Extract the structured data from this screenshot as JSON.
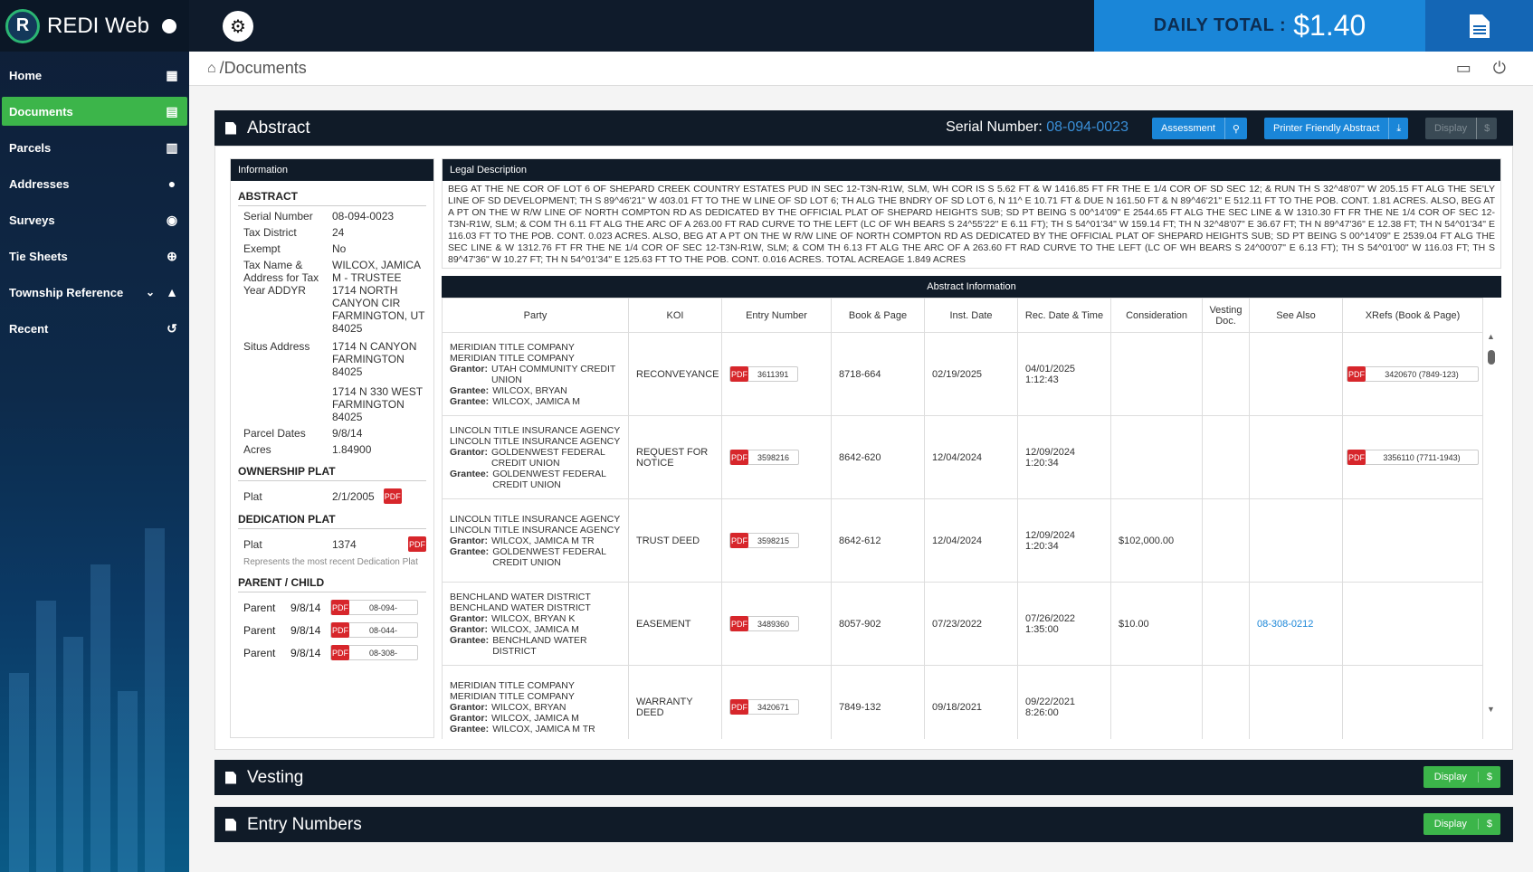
{
  "app": {
    "name": "REDI Web",
    "logo_letter": "R"
  },
  "topbar": {
    "daily_label": "DAILY TOTAL :",
    "daily_value": "$1.40"
  },
  "nav": [
    {
      "label": "Home",
      "icon": "dashboard-icon",
      "glyph": "▦"
    },
    {
      "label": "Documents",
      "icon": "file-icon",
      "glyph": "▤",
      "active": true
    },
    {
      "label": "Parcels",
      "icon": "map-icon",
      "glyph": "▥"
    },
    {
      "label": "Addresses",
      "icon": "map-pin-icon",
      "glyph": "●"
    },
    {
      "label": "Surveys",
      "icon": "compass-icon",
      "glyph": "◉"
    },
    {
      "label": "Tie Sheets",
      "icon": "crosshair-icon",
      "glyph": "⊕"
    },
    {
      "label": "Township Reference",
      "icon": "mountain-icon",
      "glyph": "▲",
      "expandable": true
    },
    {
      "label": "Recent",
      "icon": "history-icon",
      "glyph": "↺"
    }
  ],
  "breadcrumb": {
    "path": "/Documents"
  },
  "abstract": {
    "title": "Abstract",
    "serial_label": "Serial Number:",
    "serial_value": "08-094-0023",
    "assessment_label": "Assessment",
    "printer_label": "Printer Friendly Abstract",
    "display_label": "Display",
    "price_symbol": "$"
  },
  "info": {
    "header": "Information",
    "abstract_title": "ABSTRACT",
    "serial_number_label": "Serial Number",
    "serial_number": "08-094-0023",
    "tax_district_label": "Tax District",
    "tax_district": "24",
    "exempt_label": "Exempt",
    "exempt": "No",
    "tax_name_label": "Tax Name & Address for Tax Year ADDYR",
    "tax_name": "WILCOX, JAMICA M - TRUSTEE 1714 NORTH CANYON CIR FARMINGTON, UT 84025",
    "situs_label": "Situs Address",
    "situs_1": "1714 N CANYON FARMINGTON 84025",
    "situs_2": "1714 N 330 WEST FARMINGTON 84025",
    "parcel_dates_label": "Parcel Dates",
    "parcel_dates": "9/8/14",
    "acres_label": "Acres",
    "acres": "1.84900",
    "ownership_title": "OWNERSHIP PLAT",
    "ownership_plat_label": "Plat",
    "ownership_plat_value": "2/1/2005",
    "dedication_title": "DEDICATION PLAT",
    "dedication_plat_label": "Plat",
    "dedication_plat_value": "1374",
    "dedication_note": "Represents the most recent Dedication Plat",
    "parent_child_title": "PARENT / CHILD",
    "parents": [
      {
        "label": "Parent",
        "date": "9/8/14",
        "ref": "08-094-"
      },
      {
        "label": "Parent",
        "date": "9/8/14",
        "ref": "08-044-"
      },
      {
        "label": "Parent",
        "date": "9/8/14",
        "ref": "08-308-"
      }
    ]
  },
  "legal": {
    "header": "Legal Description",
    "text": "BEG AT THE NE COR OF LOT 6 OF SHEPARD CREEK COUNTRY ESTATES PUD IN SEC 12-T3N-R1W, SLM, WH COR IS S 5.62 FT & W 1416.85 FT FR THE E 1/4 COR OF SD SEC 12; & RUN TH S 32^48'07\" W 205.15 FT ALG THE SE'LY LINE OF SD DEVELOPMENT; TH S 89^46'21\" W 403.01 FT TO THE W LINE OF SD LOT 6; TH ALG THE BNDRY OF SD LOT 6, N 11^ E 10.71 FT & DUE N 161.50 FT & N 89^46'21\" E 512.11 FT TO THE POB. CONT. 1.81 ACRES. ALSO, BEG AT A PT ON THE W R/W LINE OF NORTH COMPTON RD AS DEDICATED BY THE OFFICIAL PLAT OF SHEPARD HEIGHTS SUB; SD PT BEING S 00^14'09\" E 2544.65 FT ALG THE SEC LINE & W 1310.30 FT FR THE NE 1/4 COR OF SEC 12-T3N-R1W, SLM; & COM TH 6.11 FT ALG THE ARC OF A 263.00 FT RAD CURVE TO THE LEFT (LC OF WH BEARS S 24^55'22\" E 6.11 FT); TH S 54^01'34\" W 159.14 FT; TH N 32^48'07\" E 36.67 FT; TH N 89^47'36\" E 12.38 FT; TH N 54^01'34\" E 116.03 FT TO THE POB. CONT. 0.023 ACRES. ALSO, BEG AT A PT ON THE W R/W LINE OF NORTH COMPTON RD AS DEDICATED BY THE OFFICIAL PLAT OF SHEPARD HEIGHTS SUB; SD PT BEING S 00^14'09\" E 2539.04 FT ALG THE SEC LINE & W 1312.76 FT FR THE NE 1/4 COR OF SEC 12-T3N-R1W, SLM; & COM TH 6.13 FT ALG THE ARC OF A 263.60 FT RAD CURVE TO THE LEFT (LC OF WH BEARS S 24^00'07\" E 6.13 FT); TH S 54^01'00\" W 116.03 FT; TH S 89^47'36\" W 10.27 FT; TH N 54^01'34\" E 125.63 FT TO THE POB. CONT. 0.016 ACRES. TOTAL ACREAGE 1.849 ACRES"
  },
  "absinfo": {
    "header": "Abstract Information",
    "columns": [
      "Party",
      "KOI",
      "Entry Number",
      "Book & Page",
      "Inst. Date",
      "Rec. Date & Time",
      "Consideration",
      "Vesting Doc.",
      "See Also",
      "XRefs (Book & Page)"
    ],
    "rows": [
      {
        "party": [
          {
            "t": "MERIDIAN TITLE COMPANY"
          },
          {
            "t": "MERIDIAN TITLE COMPANY"
          },
          {
            "k": "Grantor:",
            "t": "UTAH COMMUNITY CREDIT UNION"
          },
          {
            "k": "Grantee:",
            "t": "WILCOX, BRYAN"
          },
          {
            "k": "Grantee:",
            "t": "WILCOX, JAMICA M"
          }
        ],
        "koi": "RECONVEYANCE",
        "entry": "3611391",
        "book": "8718-664",
        "inst": "02/19/2025",
        "rec": "04/01/2025 1:12:43",
        "consideration": "",
        "vesting": "",
        "see_also": "",
        "xref": "3420670 (7849-123)"
      },
      {
        "party": [
          {
            "t": "LINCOLN TITLE INSURANCE AGENCY"
          },
          {
            "t": "LINCOLN TITLE INSURANCE AGENCY"
          },
          {
            "k": "Grantor:",
            "t": "GOLDENWEST FEDERAL CREDIT UNION"
          },
          {
            "k": "Grantee:",
            "t": "GOLDENWEST FEDERAL CREDIT UNION"
          }
        ],
        "koi": "REQUEST FOR NOTICE",
        "entry": "3598216",
        "book": "8642-620",
        "inst": "12/04/2024",
        "rec": "12/09/2024 1:20:34",
        "consideration": "",
        "vesting": "",
        "see_also": "",
        "xref": "3356110 (7711-1943)"
      },
      {
        "party": [
          {
            "t": "LINCOLN TITLE INSURANCE AGENCY"
          },
          {
            "t": "LINCOLN TITLE INSURANCE AGENCY"
          },
          {
            "k": "Grantor:",
            "t": "WILCOX, JAMICA M TR"
          },
          {
            "k": "Grantee:",
            "t": "GOLDENWEST FEDERAL CREDIT UNION"
          }
        ],
        "koi": "TRUST DEED",
        "entry": "3598215",
        "book": "8642-612",
        "inst": "12/04/2024",
        "rec": "12/09/2024 1:20:34",
        "consideration": "$102,000.00",
        "vesting": "",
        "see_also": "",
        "xref": ""
      },
      {
        "party": [
          {
            "t": "BENCHLAND WATER DISTRICT"
          },
          {
            "t": "BENCHLAND WATER DISTRICT"
          },
          {
            "k": "Grantor:",
            "t": "WILCOX, BRYAN K"
          },
          {
            "k": "Grantor:",
            "t": "WILCOX, JAMICA M"
          },
          {
            "k": "Grantee:",
            "t": "BENCHLAND WATER DISTRICT"
          }
        ],
        "koi": "EASEMENT",
        "entry": "3489360",
        "book": "8057-902",
        "inst": "07/23/2022",
        "rec": "07/26/2022 1:35:00",
        "consideration": "$10.00",
        "vesting": "",
        "see_also": "08-308-0212",
        "xref": ""
      },
      {
        "party": [
          {
            "t": "MERIDIAN TITLE COMPANY"
          },
          {
            "t": "MERIDIAN TITLE COMPANY"
          },
          {
            "k": "Grantor:",
            "t": "WILCOX, BRYAN"
          },
          {
            "k": "Grantor:",
            "t": "WILCOX, JAMICA M"
          },
          {
            "k": "Grantee:",
            "t": "WILCOX, JAMICA M TR"
          }
        ],
        "koi": "WARRANTY DEED",
        "entry": "3420671",
        "book": "7849-132",
        "inst": "09/18/2021",
        "rec": "09/22/2021 8:26:00",
        "consideration": "",
        "vesting": "",
        "see_also": "",
        "xref": ""
      }
    ]
  },
  "vesting": {
    "title": "Vesting",
    "display_label": "Display",
    "price_symbol": "$"
  },
  "entry_numbers": {
    "title": "Entry Numbers",
    "display_label": "Display",
    "price_symbol": "$"
  }
}
